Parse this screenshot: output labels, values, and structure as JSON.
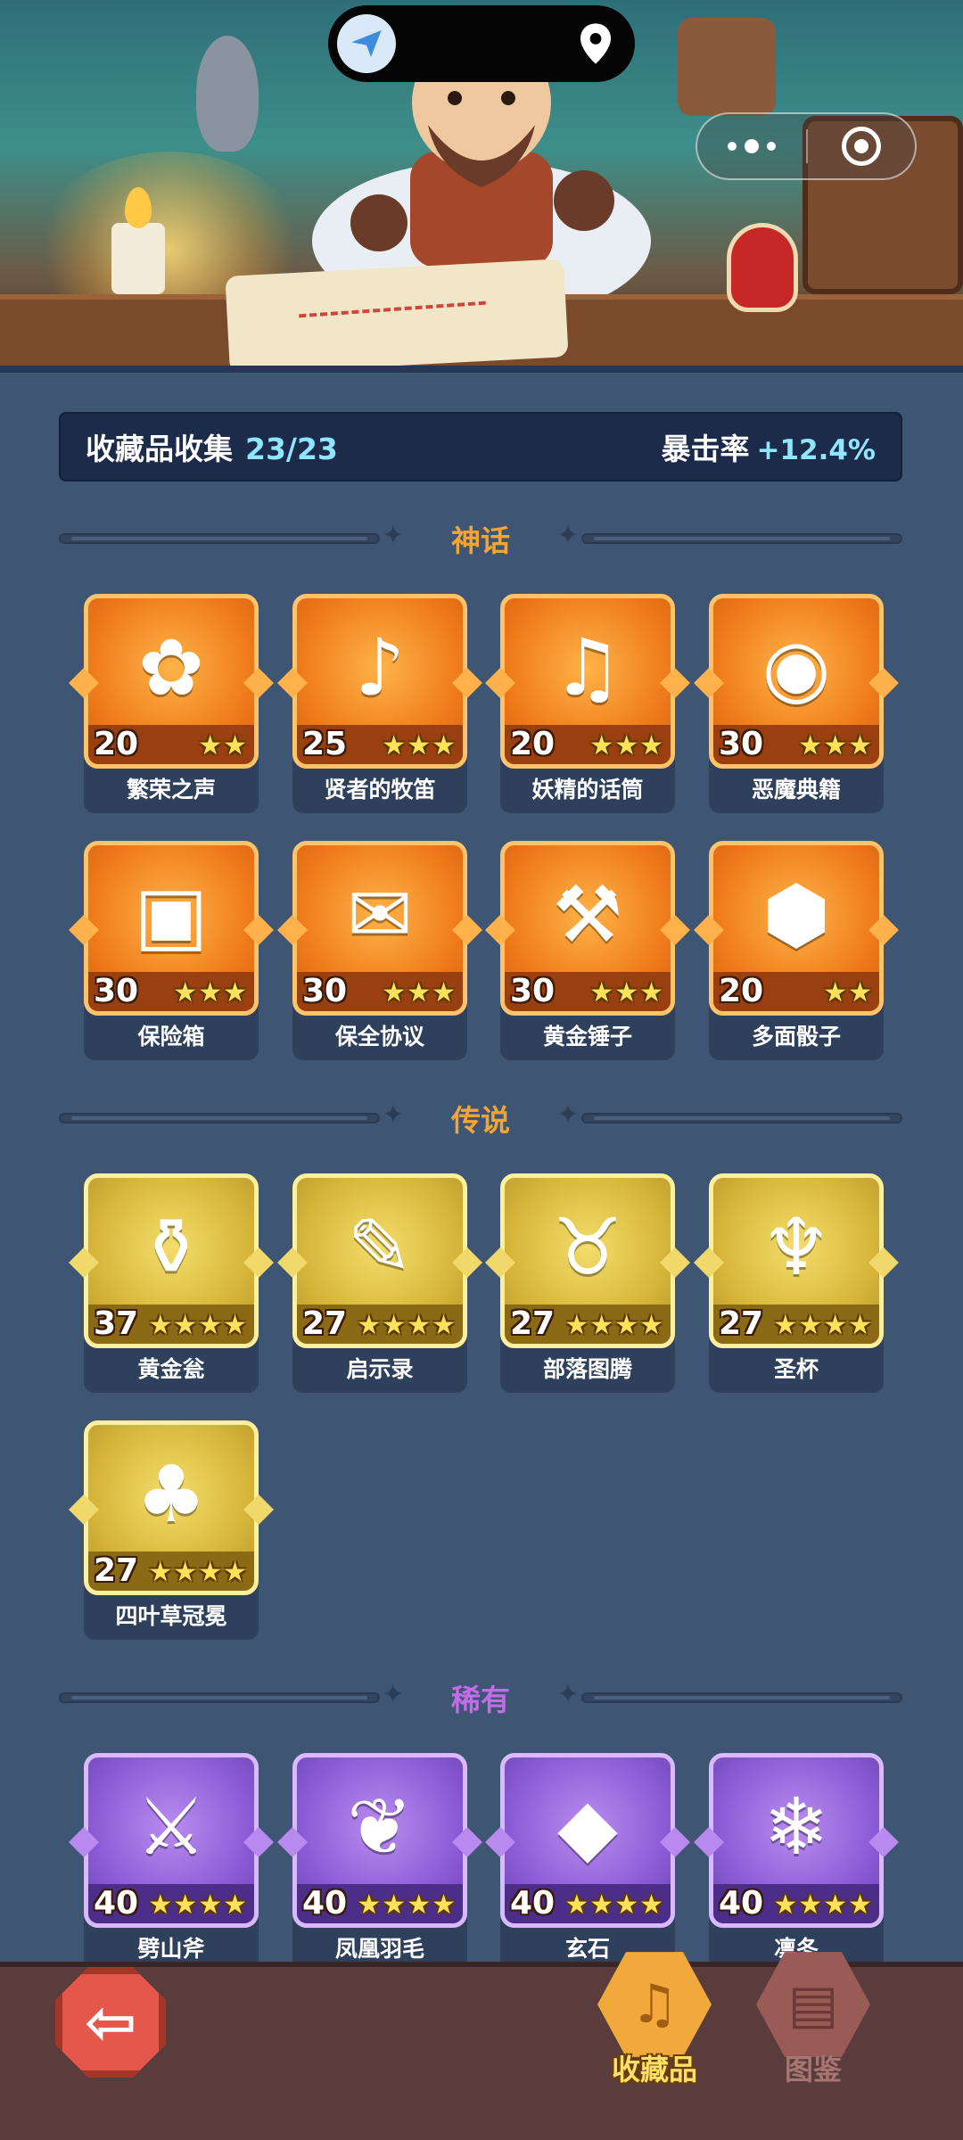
{
  "header": {
    "capsule_icons": [
      "paper-plane-icon",
      "location-pin-icon"
    ],
    "mini_program_controls": [
      "more-dots-icon",
      "close-target-icon"
    ]
  },
  "summary": {
    "collection_label": "收藏品收集",
    "collection_value": "23/23",
    "crit_label": "暴击率",
    "crit_value": "+12.4%"
  },
  "sections": [
    {
      "title": "神话",
      "title_color": "#f3a533",
      "rarity": "mythic",
      "items": [
        {
          "name": "繁荣之声",
          "level": "20",
          "stars": 2,
          "icon": "✿"
        },
        {
          "name": "贤者的牧笛",
          "level": "25",
          "stars": 3,
          "icon": "♪"
        },
        {
          "name": "妖精的话筒",
          "level": "20",
          "stars": 3,
          "icon": "♫"
        },
        {
          "name": "恶魔典籍",
          "level": "30",
          "stars": 3,
          "icon": "◉"
        },
        {
          "name": "保险箱",
          "level": "30",
          "stars": 3,
          "icon": "▣"
        },
        {
          "name": "保全协议",
          "level": "30",
          "stars": 3,
          "icon": "✉"
        },
        {
          "name": "黄金锤子",
          "level": "30",
          "stars": 3,
          "icon": "⚒"
        },
        {
          "name": "多面骰子",
          "level": "20",
          "stars": 2,
          "icon": "⬢"
        }
      ]
    },
    {
      "title": "传说",
      "title_color": "#f3a533",
      "rarity": "legend",
      "items": [
        {
          "name": "黄金瓮",
          "level": "37",
          "stars": 4,
          "icon": "⚱"
        },
        {
          "name": "启示录",
          "level": "27",
          "stars": 4,
          "icon": "✎"
        },
        {
          "name": "部落图腾",
          "level": "27",
          "stars": 4,
          "icon": "♉"
        },
        {
          "name": "圣杯",
          "level": "27",
          "stars": 4,
          "icon": "♆"
        },
        {
          "name": "四叶草冠冕",
          "level": "27",
          "stars": 4,
          "icon": "♣"
        }
      ]
    },
    {
      "title": "稀有",
      "title_color": "#c36be8",
      "rarity": "rare",
      "items": [
        {
          "name": "劈山斧",
          "level": "40",
          "stars": 4,
          "icon": "⚔"
        },
        {
          "name": "凤凰羽毛",
          "level": "40",
          "stars": 4,
          "icon": "❦"
        },
        {
          "name": "玄石",
          "level": "40",
          "stars": 4,
          "icon": "◆"
        },
        {
          "name": "凛冬",
          "level": "40",
          "stars": 4,
          "icon": "❄"
        }
      ]
    }
  ],
  "bottom_nav": {
    "back_icon": "back-arrow-icon",
    "tabs": [
      {
        "label": "收藏品",
        "icon": "lyre-icon",
        "active": true
      },
      {
        "label": "图鉴",
        "icon": "book-icon",
        "active": false
      }
    ]
  },
  "colors": {
    "background": "#3e5573",
    "accent_cyan": "#8ee6ff",
    "mythic": "#f07d1c",
    "legend": "#d7b63a",
    "rare": "#8c5cd6"
  }
}
